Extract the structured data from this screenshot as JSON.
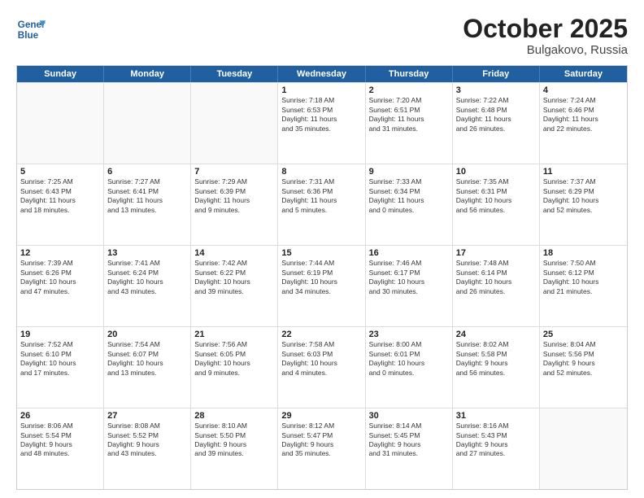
{
  "header": {
    "logo_line1": "General",
    "logo_line2": "Blue",
    "month": "October 2025",
    "location": "Bulgakovo, Russia"
  },
  "weekdays": [
    "Sunday",
    "Monday",
    "Tuesday",
    "Wednesday",
    "Thursday",
    "Friday",
    "Saturday"
  ],
  "rows": [
    [
      {
        "day": "",
        "text": ""
      },
      {
        "day": "",
        "text": ""
      },
      {
        "day": "",
        "text": ""
      },
      {
        "day": "1",
        "text": "Sunrise: 7:18 AM\nSunset: 6:53 PM\nDaylight: 11 hours\nand 35 minutes."
      },
      {
        "day": "2",
        "text": "Sunrise: 7:20 AM\nSunset: 6:51 PM\nDaylight: 11 hours\nand 31 minutes."
      },
      {
        "day": "3",
        "text": "Sunrise: 7:22 AM\nSunset: 6:48 PM\nDaylight: 11 hours\nand 26 minutes."
      },
      {
        "day": "4",
        "text": "Sunrise: 7:24 AM\nSunset: 6:46 PM\nDaylight: 11 hours\nand 22 minutes."
      }
    ],
    [
      {
        "day": "5",
        "text": "Sunrise: 7:25 AM\nSunset: 6:43 PM\nDaylight: 11 hours\nand 18 minutes."
      },
      {
        "day": "6",
        "text": "Sunrise: 7:27 AM\nSunset: 6:41 PM\nDaylight: 11 hours\nand 13 minutes."
      },
      {
        "day": "7",
        "text": "Sunrise: 7:29 AM\nSunset: 6:39 PM\nDaylight: 11 hours\nand 9 minutes."
      },
      {
        "day": "8",
        "text": "Sunrise: 7:31 AM\nSunset: 6:36 PM\nDaylight: 11 hours\nand 5 minutes."
      },
      {
        "day": "9",
        "text": "Sunrise: 7:33 AM\nSunset: 6:34 PM\nDaylight: 11 hours\nand 0 minutes."
      },
      {
        "day": "10",
        "text": "Sunrise: 7:35 AM\nSunset: 6:31 PM\nDaylight: 10 hours\nand 56 minutes."
      },
      {
        "day": "11",
        "text": "Sunrise: 7:37 AM\nSunset: 6:29 PM\nDaylight: 10 hours\nand 52 minutes."
      }
    ],
    [
      {
        "day": "12",
        "text": "Sunrise: 7:39 AM\nSunset: 6:26 PM\nDaylight: 10 hours\nand 47 minutes."
      },
      {
        "day": "13",
        "text": "Sunrise: 7:41 AM\nSunset: 6:24 PM\nDaylight: 10 hours\nand 43 minutes."
      },
      {
        "day": "14",
        "text": "Sunrise: 7:42 AM\nSunset: 6:22 PM\nDaylight: 10 hours\nand 39 minutes."
      },
      {
        "day": "15",
        "text": "Sunrise: 7:44 AM\nSunset: 6:19 PM\nDaylight: 10 hours\nand 34 minutes."
      },
      {
        "day": "16",
        "text": "Sunrise: 7:46 AM\nSunset: 6:17 PM\nDaylight: 10 hours\nand 30 minutes."
      },
      {
        "day": "17",
        "text": "Sunrise: 7:48 AM\nSunset: 6:14 PM\nDaylight: 10 hours\nand 26 minutes."
      },
      {
        "day": "18",
        "text": "Sunrise: 7:50 AM\nSunset: 6:12 PM\nDaylight: 10 hours\nand 21 minutes."
      }
    ],
    [
      {
        "day": "19",
        "text": "Sunrise: 7:52 AM\nSunset: 6:10 PM\nDaylight: 10 hours\nand 17 minutes."
      },
      {
        "day": "20",
        "text": "Sunrise: 7:54 AM\nSunset: 6:07 PM\nDaylight: 10 hours\nand 13 minutes."
      },
      {
        "day": "21",
        "text": "Sunrise: 7:56 AM\nSunset: 6:05 PM\nDaylight: 10 hours\nand 9 minutes."
      },
      {
        "day": "22",
        "text": "Sunrise: 7:58 AM\nSunset: 6:03 PM\nDaylight: 10 hours\nand 4 minutes."
      },
      {
        "day": "23",
        "text": "Sunrise: 8:00 AM\nSunset: 6:01 PM\nDaylight: 10 hours\nand 0 minutes."
      },
      {
        "day": "24",
        "text": "Sunrise: 8:02 AM\nSunset: 5:58 PM\nDaylight: 9 hours\nand 56 minutes."
      },
      {
        "day": "25",
        "text": "Sunrise: 8:04 AM\nSunset: 5:56 PM\nDaylight: 9 hours\nand 52 minutes."
      }
    ],
    [
      {
        "day": "26",
        "text": "Sunrise: 8:06 AM\nSunset: 5:54 PM\nDaylight: 9 hours\nand 48 minutes."
      },
      {
        "day": "27",
        "text": "Sunrise: 8:08 AM\nSunset: 5:52 PM\nDaylight: 9 hours\nand 43 minutes."
      },
      {
        "day": "28",
        "text": "Sunrise: 8:10 AM\nSunset: 5:50 PM\nDaylight: 9 hours\nand 39 minutes."
      },
      {
        "day": "29",
        "text": "Sunrise: 8:12 AM\nSunset: 5:47 PM\nDaylight: 9 hours\nand 35 minutes."
      },
      {
        "day": "30",
        "text": "Sunrise: 8:14 AM\nSunset: 5:45 PM\nDaylight: 9 hours\nand 31 minutes."
      },
      {
        "day": "31",
        "text": "Sunrise: 8:16 AM\nSunset: 5:43 PM\nDaylight: 9 hours\nand 27 minutes."
      },
      {
        "day": "",
        "text": ""
      }
    ]
  ]
}
